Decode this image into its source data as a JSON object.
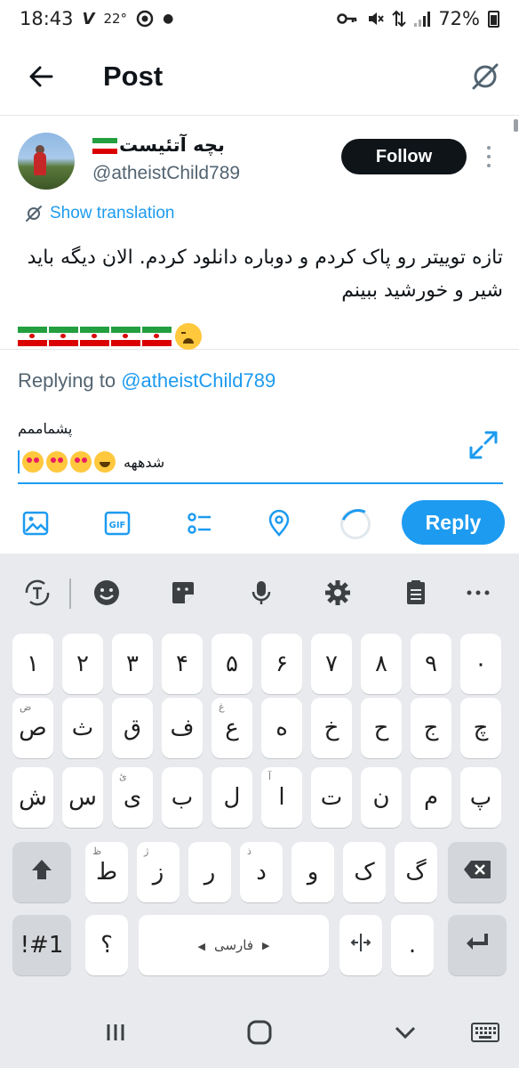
{
  "status_bar": {
    "time": "18:43",
    "carrier_mark": "V",
    "temperature": "22°",
    "battery": "72%",
    "icons": [
      "key-icon",
      "mute-icon",
      "data-arrows-icon",
      "signal-icon",
      "battery-icon"
    ]
  },
  "app_bar": {
    "title": "Post"
  },
  "tweet": {
    "display_name": "بچه آتئیست",
    "handle": "@atheistChild789",
    "follow_label": "Follow",
    "translation_label": "Show translation",
    "text": "تازه توییتر رو پاک کردم و دوباره دانلود کردم. الان دیگه باید شیر و خورشید ببینم",
    "emoji_flags_count": 5
  },
  "reply": {
    "replying_prefix": "Replying to",
    "replying_handle": "@atheistChild789",
    "line1": "پشماممم",
    "line2": "شدههه",
    "reply_label": "Reply"
  },
  "keyboard": {
    "language_label": "فارسی",
    "digits": [
      "۱",
      "۲",
      "۳",
      "۴",
      "۵",
      "۶",
      "۷",
      "۸",
      "۹",
      "۰"
    ],
    "row1": [
      {
        "k": "ص",
        "h": "ض"
      },
      {
        "k": "ث",
        "h": ""
      },
      {
        "k": "ق",
        "h": ""
      },
      {
        "k": "ف",
        "h": ""
      },
      {
        "k": "ع",
        "h": "غ"
      },
      {
        "k": "ه",
        "h": ""
      },
      {
        "k": "خ",
        "h": ""
      },
      {
        "k": "ح",
        "h": ""
      },
      {
        "k": "ج",
        "h": ""
      },
      {
        "k": "چ",
        "h": ""
      }
    ],
    "row2": [
      {
        "k": "ش",
        "h": ""
      },
      {
        "k": "س",
        "h": ""
      },
      {
        "k": "ی",
        "h": "ئ"
      },
      {
        "k": "ب",
        "h": ""
      },
      {
        "k": "ل",
        "h": ""
      },
      {
        "k": "ا",
        "h": "آ"
      },
      {
        "k": "ت",
        "h": ""
      },
      {
        "k": "ن",
        "h": ""
      },
      {
        "k": "م",
        "h": ""
      },
      {
        "k": "پ",
        "h": ""
      }
    ],
    "row3": [
      {
        "k": "ط",
        "h": "ظ"
      },
      {
        "k": "ز",
        "h": "ژ"
      },
      {
        "k": "ر",
        "h": ""
      },
      {
        "k": "د",
        "h": "ذ"
      },
      {
        "k": "و",
        "h": ""
      },
      {
        "k": "ک",
        "h": ""
      },
      {
        "k": "گ",
        "h": ""
      }
    ],
    "symbols_label": "!#1",
    "question_key": "؟",
    "period_key": "."
  }
}
